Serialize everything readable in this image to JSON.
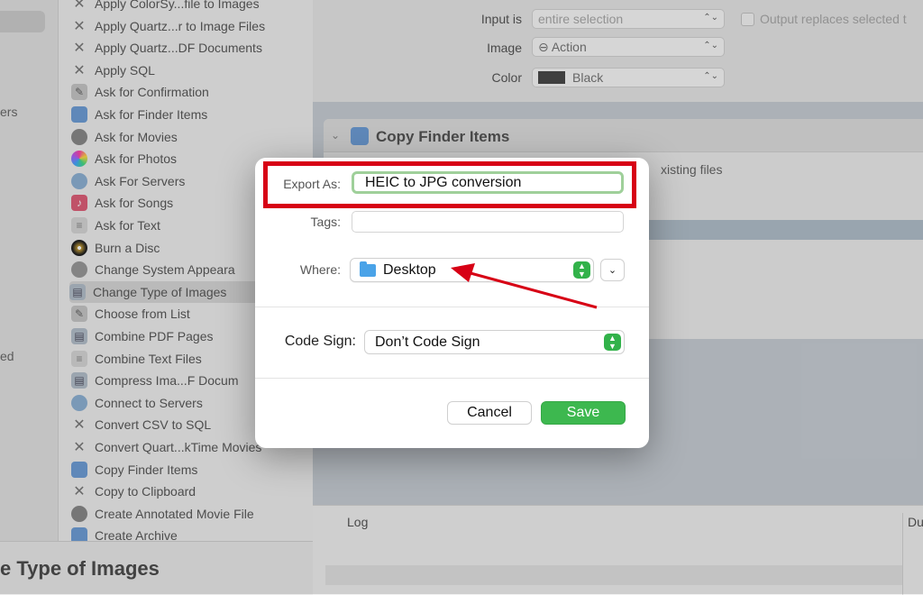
{
  "source_fragments": [
    "",
    "ers",
    "ed"
  ],
  "actions": [
    {
      "label": "Apply ColorSy...file to Images",
      "icon": "tools-icon"
    },
    {
      "label": "Apply Quartz...r to Image Files",
      "icon": "tools-icon"
    },
    {
      "label": "Apply Quartz...DF Documents",
      "icon": "tools-icon"
    },
    {
      "label": "Apply SQL",
      "icon": "tools-icon"
    },
    {
      "label": "Ask for Confirmation",
      "icon": "pen-icon"
    },
    {
      "label": "Ask for Finder Items",
      "icon": "finder-icon"
    },
    {
      "label": "Ask for Movies",
      "icon": "movie-icon"
    },
    {
      "label": "Ask for Photos",
      "icon": "photos-icon"
    },
    {
      "label": "Ask For Servers",
      "icon": "globe-icon"
    },
    {
      "label": "Ask for Songs",
      "icon": "music-icon"
    },
    {
      "label": "Ask for Text",
      "icon": "text-icon"
    },
    {
      "label": "Burn a Disc",
      "icon": "disc-icon"
    },
    {
      "label": "Change System Appeara",
      "icon": "gear-icon"
    },
    {
      "label": "Change Type of Images",
      "icon": "image-icon",
      "selected": true
    },
    {
      "label": "Choose from List",
      "icon": "pen-icon"
    },
    {
      "label": "Combine PDF Pages",
      "icon": "image-icon"
    },
    {
      "label": "Combine Text Files",
      "icon": "text-icon"
    },
    {
      "label": "Compress Ima...F Docum",
      "icon": "image-icon"
    },
    {
      "label": "Connect to Servers",
      "icon": "globe-icon"
    },
    {
      "label": "Convert CSV to SQL",
      "icon": "tools-icon"
    },
    {
      "label": "Convert Quart...kTime Movies",
      "icon": "tools-icon"
    },
    {
      "label": "Copy Finder Items",
      "icon": "finder-icon"
    },
    {
      "label": "Copy to Clipboard",
      "icon": "tools-icon"
    },
    {
      "label": "Create Annotated Movie File",
      "icon": "movie-icon"
    },
    {
      "label": "Create Archive",
      "icon": "finder-icon"
    }
  ],
  "footer_title": "e Type of Images",
  "workflow": {
    "input_is_label": "Input is",
    "input_is_value": "entire selection",
    "output_replaces": "Output replaces selected t",
    "image_label": "Image",
    "image_value": "⊖ Action",
    "color_label": "Color",
    "color_value": "Black",
    "copy_finder_title": "Copy Finder Items",
    "copy_finder_text": "xisting files"
  },
  "log": {
    "header": "Log",
    "duration_header": "Du"
  },
  "dialog": {
    "export_as_label": "Export As:",
    "export_as_value": "HEIC to JPG conversion",
    "tags_label": "Tags:",
    "where_label": "Where:",
    "where_value": "Desktop",
    "code_sign_label": "Code Sign:",
    "code_sign_value": "Don’t Code Sign",
    "cancel_label": "Cancel",
    "save_label": "Save"
  },
  "colors": {
    "highlight": "#d70015",
    "save_button": "#3db84f",
    "stepper": "#32b24a"
  }
}
